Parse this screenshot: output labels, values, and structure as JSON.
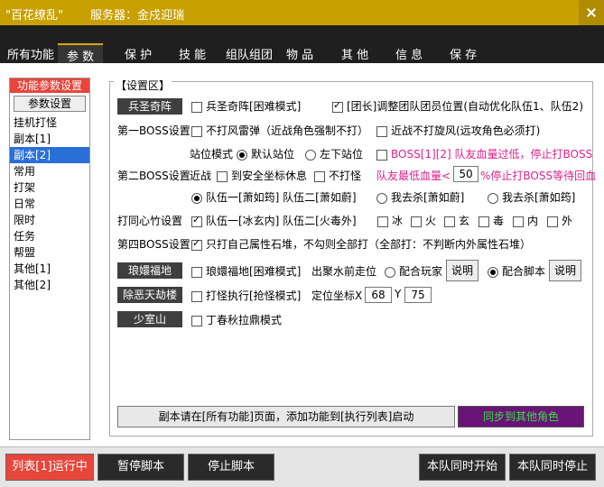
{
  "window": {
    "app_name": "\"百花缭乱\"",
    "server_label": "服务器：金戍迎瑞"
  },
  "tabs": [
    "所有功能",
    "参 数",
    "保 护",
    "技 能",
    "组队组团",
    "物 品",
    "其 他",
    "信 息",
    "保 存"
  ],
  "sidebar": {
    "header": "功能参数设置",
    "subheader": "参数设置",
    "items": [
      "挂机打怪",
      "副本[1]",
      "副本[2]",
      "常用",
      "打架",
      "日常",
      "限时",
      "任务",
      "帮盟",
      "其他[1]",
      "其他[2]"
    ],
    "selected": "副本[2]"
  },
  "panel": {
    "title": "【设置区】",
    "bing_sheng": {
      "label": "兵圣奇阵",
      "hard_mode": "兵圣奇阵[困难模式]",
      "adjust_team": "[团长]调整团队团员位置(自动优化队伍1、队伍2)"
    },
    "boss1": {
      "label": "第一BOSS设置",
      "no_thunder": "不打风雷弹（近战角色强制不打）",
      "no_whirl": "近战不打旋风(远攻角色必须打)"
    },
    "boss2": {
      "label": "第二BOSS设置",
      "stand_label": "站位模式",
      "default_stand": "默认站位",
      "left_down_stand": "左下站位",
      "warn_text": "BOSS[1][2] 队友血量过低，停止打BOSS",
      "melee": "近战",
      "to_safe": "到安全坐标休息",
      "no_fight": "不打怪",
      "min_hp_label": "队友最低血量<",
      "min_hp_value": "50",
      "stop_text": "%停止打BOSS等待回血",
      "opt1": "队伍一[萧如筠] 队伍二[萧如蔚]",
      "opt2": "我去杀[萧如蔚]",
      "opt3": "我去杀[萧如筠]"
    },
    "tong_xin": {
      "label": "打同心竹设置",
      "team": "队伍一[冰玄内] 队伍二[火毒外]",
      "elements": [
        "冰",
        "火",
        "玄",
        "毒",
        "内",
        "外"
      ]
    },
    "boss4": {
      "label": "第四BOSS设置",
      "text": "只打自己属性石堆，不勾则全部打（全部打：不判断内外属性石堆）"
    },
    "lang_huan": {
      "label": "琅嬛福地",
      "hard_mode": "琅嬛福地[困难模式]",
      "water_label": "出聚水前走位",
      "opt_player": "配合玩家",
      "explain": "说明",
      "opt_script": "配合脚本"
    },
    "chu_e": {
      "label": "除恶天劫楼",
      "mode": "打怪执行[抢怪模式]",
      "coord_label": "定位坐标X",
      "x": "68",
      "y_label": "Y",
      "y": "75"
    },
    "shao_shi": {
      "label": "少室山",
      "mode": "丁春秋拉鼎模式"
    },
    "notice": "副本请在[所有功能]页面，添加功能到[执行列表]启动",
    "sync_button": "同步到其他角色"
  },
  "bottom": {
    "run": "列表[1]运行中",
    "pause": "暂停脚本",
    "stop": "停止脚本",
    "team_start": "本队同时开始",
    "team_stop": "本队同时停止"
  }
}
